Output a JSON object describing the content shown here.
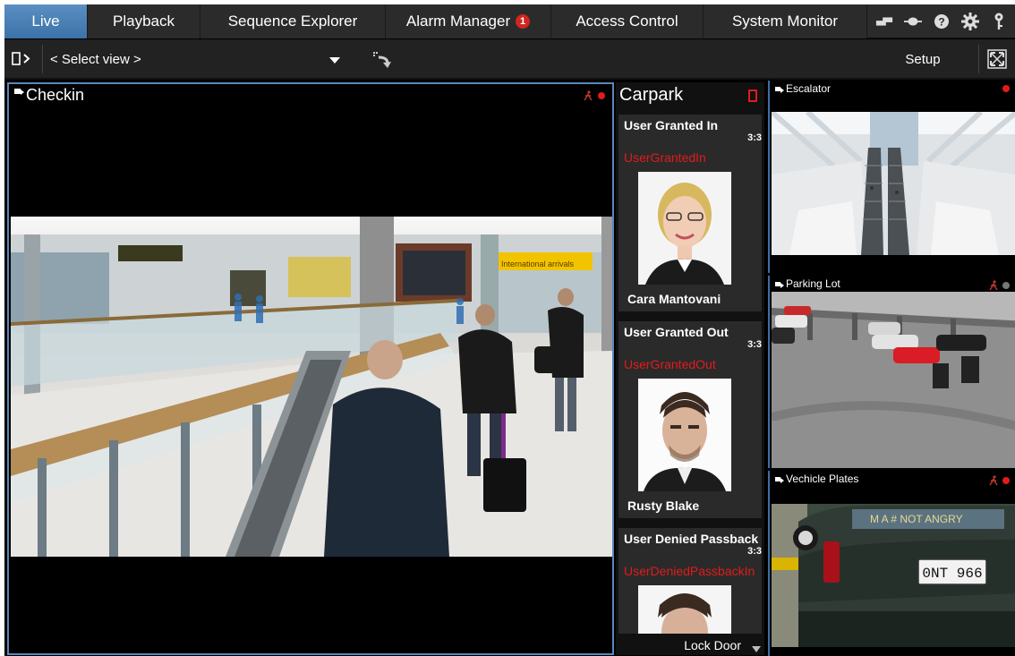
{
  "nav": {
    "tabs": [
      {
        "label": "Live",
        "active": true
      },
      {
        "label": "Playback"
      },
      {
        "label": "Sequence Explorer"
      },
      {
        "label": "Alarm Manager",
        "badge": "1"
      },
      {
        "label": "Access Control"
      },
      {
        "label": "System Monitor"
      }
    ],
    "icons": [
      "network-icon",
      "connection-icon",
      "help-icon",
      "settings-icon",
      "key-icon"
    ]
  },
  "toolbar": {
    "view_select": "< Select view >",
    "setup_label": "Setup"
  },
  "tiles": {
    "checkin": {
      "title": "Checkin"
    },
    "escalator": {
      "title": "Escalator"
    },
    "parking": {
      "title": "Parking Lot"
    },
    "plates": {
      "title": "Vechicle Plates",
      "plate_text": "0NT 966",
      "sticker_text": "M A # NOT ANGRY"
    }
  },
  "carpark": {
    "title": "Carpark",
    "events": [
      {
        "title": "User Granted In",
        "time": "3:3",
        "code": "UserGrantedIn",
        "name": "Cara Mantovani"
      },
      {
        "title": "User Granted Out",
        "time": "3:3",
        "code": "UserGrantedOut",
        "name": "Rusty Blake"
      },
      {
        "title": "User Denied Passback",
        "time": "3:3",
        "code": "UserDeniedPassbackIn",
        "name": ""
      }
    ],
    "action_label": "Lock Door"
  },
  "scene_signs": {
    "intl_arrivals": "International arrivals"
  },
  "colors": {
    "accent": "#3c72a8",
    "alert": "#e21b1b",
    "nav_bg": "#2b2b2b"
  }
}
